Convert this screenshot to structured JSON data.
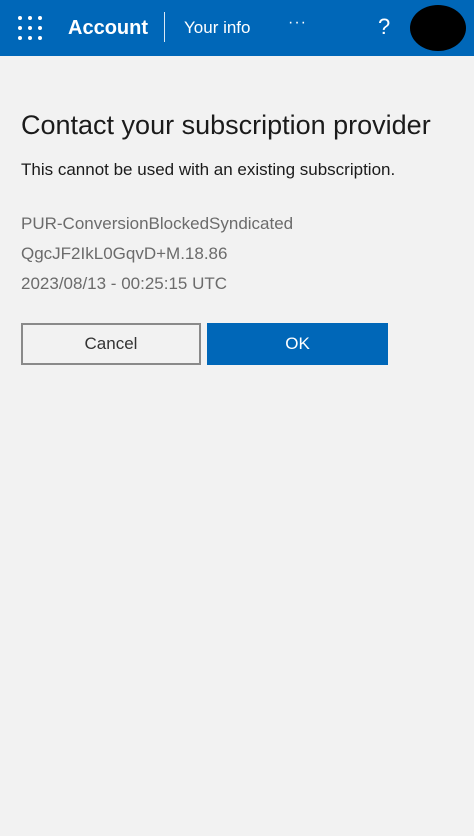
{
  "header": {
    "brand": "Account",
    "section": "Your info",
    "more": "···",
    "help": "?"
  },
  "dialog": {
    "title": "Contact your subscription provider",
    "message": "This cannot be used with an existing subscription.",
    "error_code": "PUR-ConversionBlockedSyndicated",
    "correlation_id": "QgcJF2IkL0GqvD+M.18.86",
    "timestamp": "2023/08/13 - 00:25:15 UTC",
    "cancel_label": "Cancel",
    "ok_label": "OK"
  },
  "colors": {
    "header_bg": "#0067b8",
    "page_bg": "#f2f2f2",
    "primary_button": "#0067b8"
  },
  "icons": {
    "app_launcher": "waffle-grid-icon",
    "avatar": "user-avatar"
  }
}
